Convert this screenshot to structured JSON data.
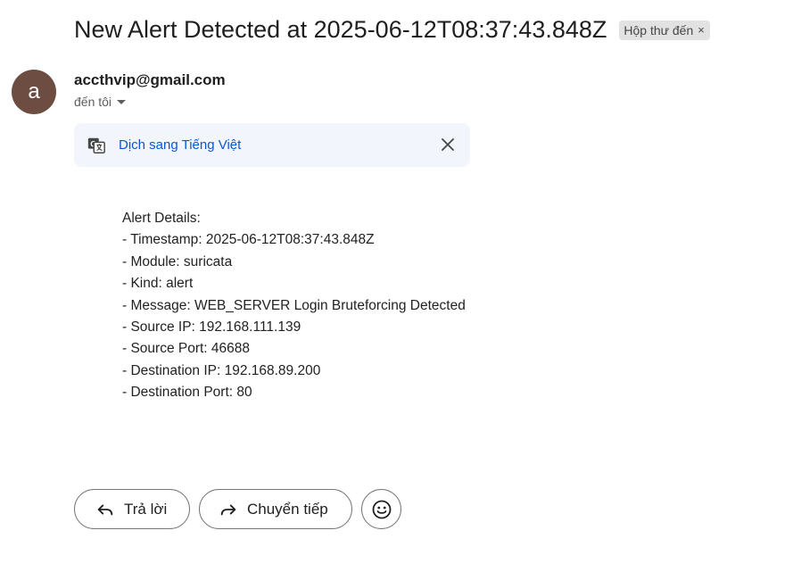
{
  "email": {
    "subject": "New Alert Detected at 2025-06-12T08:37:43.848Z",
    "label": "Hộp thư đến",
    "label_remove": "×",
    "avatar_letter": "a",
    "avatar_color": "#6d4c41",
    "sender": "accthvip@gmail.com",
    "to": "đến tôi"
  },
  "translate": {
    "link": "Dịch sang Tiếng Việt",
    "link_color": "#0b57d0"
  },
  "body": {
    "lines": [
      "Alert Details:",
      "- Timestamp: 2025-06-12T08:37:43.848Z",
      "- Module: suricata",
      "- Kind: alert",
      "- Message: WEB_SERVER Login Bruteforcing Detected",
      "- Source IP: 192.168.111.139",
      "- Source Port: 46688",
      "- Destination IP: 192.168.89.200",
      "- Destination Port: 80"
    ]
  },
  "actions": {
    "reply": "Trả lời",
    "forward": "Chuyển tiếp",
    "icons": [
      "reply-icon",
      "forward-icon",
      "emoji-icon"
    ]
  }
}
